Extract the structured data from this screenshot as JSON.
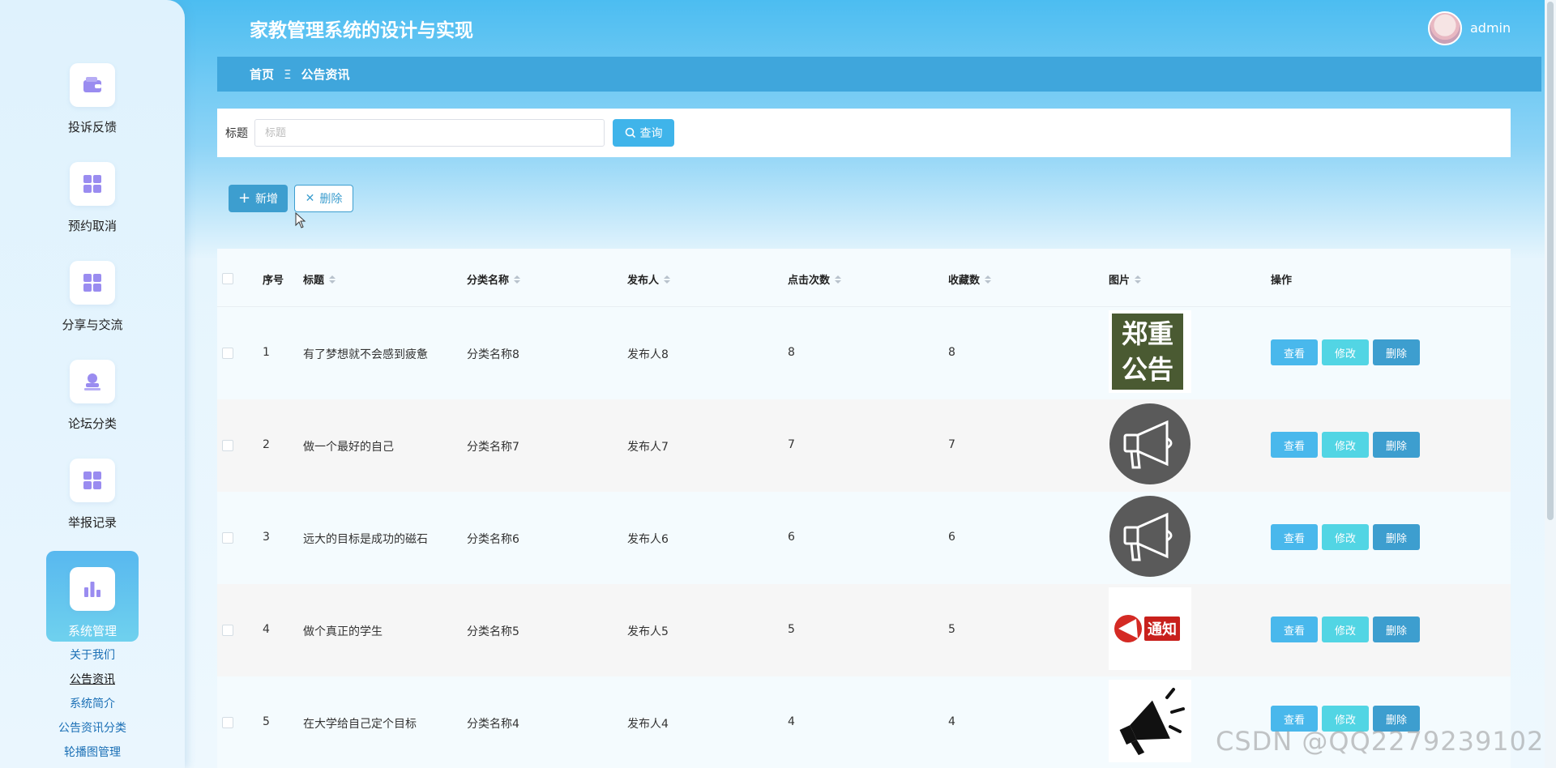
{
  "header": {
    "title": "家教管理系统的设计与实现",
    "username": "admin"
  },
  "breadcrumb": {
    "home": "首页",
    "separator": "Ξ",
    "current": "公告资讯"
  },
  "sidebar": {
    "items": [
      {
        "label": "投诉反馈",
        "icon": "wallet-icon"
      },
      {
        "label": "预约取消",
        "icon": "grid-icon"
      },
      {
        "label": "分享与交流",
        "icon": "grid-icon"
      },
      {
        "label": "论坛分类",
        "icon": "user-stamp-icon"
      },
      {
        "label": "举报记录",
        "icon": "grid-icon"
      },
      {
        "label": "系统管理",
        "icon": "bar-chart-icon",
        "active": true
      }
    ],
    "submenu": [
      "关于我们",
      "公告资讯",
      "系统简介",
      "公告资讯分类",
      "轮播图管理"
    ],
    "submenu_current": "公告资讯"
  },
  "search": {
    "label": "标题",
    "placeholder": "标题",
    "value": "",
    "button": "查询"
  },
  "actions": {
    "add": "新增",
    "delete": "删除"
  },
  "table": {
    "columns": [
      "序号",
      "标题",
      "分类名称",
      "发布人",
      "点击次数",
      "收藏数",
      "图片",
      "操作"
    ],
    "rows": [
      {
        "index": "1",
        "title": "有了梦想就不会感到疲惫",
        "category": "分类名称8",
        "publisher": "发布人8",
        "clicks": "8",
        "favorites": "8",
        "image": "zhengzhong-notice",
        "image_text": [
          "郑重",
          "公告"
        ]
      },
      {
        "index": "2",
        "title": "做一个最好的自己",
        "category": "分类名称7",
        "publisher": "发布人7",
        "clicks": "7",
        "favorites": "7",
        "image": "megaphone-circle",
        "image_text": []
      },
      {
        "index": "3",
        "title": "远大的目标是成功的磁石",
        "category": "分类名称6",
        "publisher": "发布人6",
        "clicks": "6",
        "favorites": "6",
        "image": "megaphone-circle",
        "image_text": []
      },
      {
        "index": "4",
        "title": "做个真正的学生",
        "category": "分类名称5",
        "publisher": "发布人5",
        "clicks": "5",
        "favorites": "5",
        "image": "notice-badge",
        "image_text": [
          "通知"
        ]
      },
      {
        "index": "5",
        "title": "在大学给自己定个目标",
        "category": "分类名称4",
        "publisher": "发布人4",
        "clicks": "4",
        "favorites": "4",
        "image": "megaphone-black",
        "image_text": []
      }
    ],
    "row_actions": {
      "view": "查看",
      "edit": "修改",
      "delete": "删除"
    }
  },
  "watermark": "CSDN @QQ2279239102",
  "colors": {
    "primary": "#3fb4ea",
    "breadcrumb_bg": "#3fa6dc",
    "edit": "#52d5e4",
    "delete": "#3d9ecf"
  }
}
